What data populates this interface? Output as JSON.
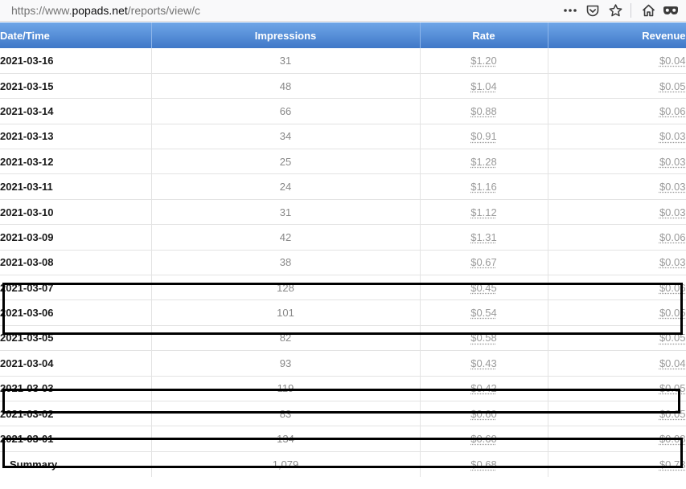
{
  "browser": {
    "url_prefix": "https://www.",
    "url_host": "popads.net",
    "url_rest": "/reports/view/c",
    "icons": [
      "more-icon",
      "pocket-icon",
      "star-icon",
      "home-icon",
      "mask-icon"
    ]
  },
  "table": {
    "headers": {
      "date": "Date/Time",
      "impressions": "Impressions",
      "rate": "Rate",
      "revenue": "Revenue"
    },
    "rows": [
      {
        "date": "2021-03-16",
        "impressions": "31",
        "rate": "$1.20",
        "revenue": "$0.04"
      },
      {
        "date": "2021-03-15",
        "impressions": "48",
        "rate": "$1.04",
        "revenue": "$0.05"
      },
      {
        "date": "2021-03-14",
        "impressions": "66",
        "rate": "$0.88",
        "revenue": "$0.06"
      },
      {
        "date": "2021-03-13",
        "impressions": "34",
        "rate": "$0.91",
        "revenue": "$0.03"
      },
      {
        "date": "2021-03-12",
        "impressions": "25",
        "rate": "$1.28",
        "revenue": "$0.03"
      },
      {
        "date": "2021-03-11",
        "impressions": "24",
        "rate": "$1.16",
        "revenue": "$0.03"
      },
      {
        "date": "2021-03-10",
        "impressions": "31",
        "rate": "$1.12",
        "revenue": "$0.03"
      },
      {
        "date": "2021-03-09",
        "impressions": "42",
        "rate": "$1.31",
        "revenue": "$0.06"
      },
      {
        "date": "2021-03-08",
        "impressions": "38",
        "rate": "$0.67",
        "revenue": "$0.03"
      },
      {
        "date": "2021-03-07",
        "impressions": "128",
        "rate": "$0.45",
        "revenue": "$0.06"
      },
      {
        "date": "2021-03-06",
        "impressions": "101",
        "rate": "$0.54",
        "revenue": "$0.05"
      },
      {
        "date": "2021-03-05",
        "impressions": "82",
        "rate": "$0.58",
        "revenue": "$0.05"
      },
      {
        "date": "2021-03-04",
        "impressions": "93",
        "rate": "$0.43",
        "revenue": "$0.04"
      },
      {
        "date": "2021-03-03",
        "impressions": "119",
        "rate": "$0.42",
        "revenue": "$0.05"
      },
      {
        "date": "2021-03-02",
        "impressions": "83",
        "rate": "$0.60",
        "revenue": "$0.05"
      },
      {
        "date": "2021-03-01",
        "impressions": "134",
        "rate": "$0.60",
        "revenue": "$0.08"
      }
    ],
    "summary": {
      "label": "Summary",
      "impressions": "1,079",
      "rate": "$0.68",
      "revenue": "$0.73"
    }
  },
  "colors": {
    "header_top": "#6fa6e8",
    "header_bottom": "#3f78c8",
    "highlight_border": "#000000"
  }
}
